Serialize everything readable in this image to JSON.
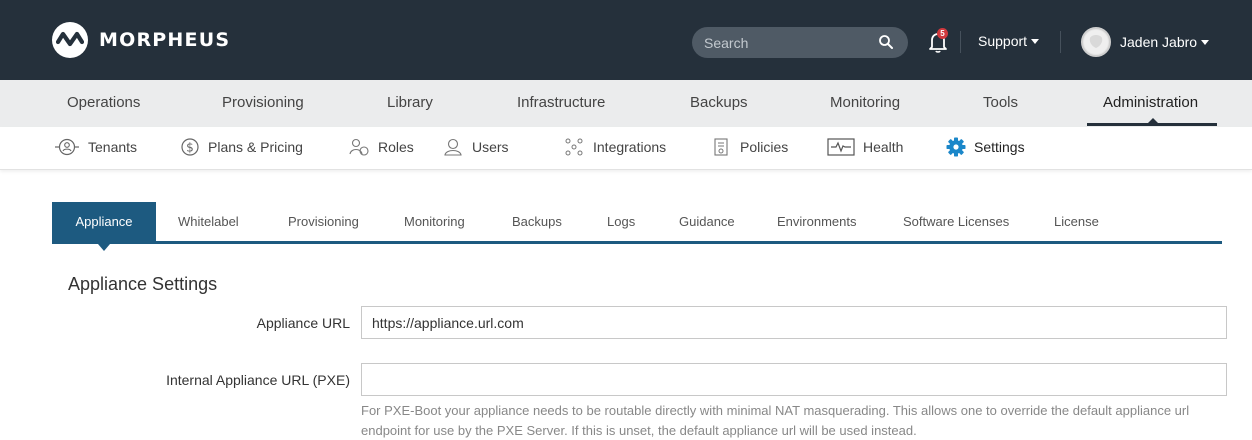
{
  "brand": {
    "name": "MORPHEUS"
  },
  "header": {
    "search_placeholder": "Search",
    "notifications_count": "5",
    "support_label": "Support",
    "user_name": "Jaden Jabro"
  },
  "main_nav": {
    "items": [
      "Operations",
      "Provisioning",
      "Library",
      "Infrastructure",
      "Backups",
      "Monitoring",
      "Tools",
      "Administration"
    ],
    "active": "Administration"
  },
  "sub_nav": {
    "items": [
      {
        "label": "Tenants",
        "icon": "tenants-icon"
      },
      {
        "label": "Plans & Pricing",
        "icon": "dollar-icon"
      },
      {
        "label": "Roles",
        "icon": "roles-icon"
      },
      {
        "label": "Users",
        "icon": "user-icon"
      },
      {
        "label": "Integrations",
        "icon": "integrations-icon"
      },
      {
        "label": "Policies",
        "icon": "policies-icon"
      },
      {
        "label": "Health",
        "icon": "health-icon"
      },
      {
        "label": "Settings",
        "icon": "gear-icon"
      }
    ],
    "active": "Settings"
  },
  "tabs": {
    "items": [
      "Appliance",
      "Whitelabel",
      "Provisioning",
      "Monitoring",
      "Backups",
      "Logs",
      "Guidance",
      "Environments",
      "Software Licenses",
      "License"
    ],
    "active": "Appliance"
  },
  "form": {
    "section_title": "Appliance Settings",
    "appliance_url_label": "Appliance URL",
    "appliance_url_value": "https://appliance.url.com",
    "internal_url_label": "Internal Appliance URL (PXE)",
    "internal_url_value": "",
    "internal_url_help": "For PXE-Boot your appliance needs to be routable directly with minimal NAT masquerading. This allows one to override the default appliance url endpoint for use by the PXE Server. If this is unset, the default appliance url will be used instead."
  },
  "colors": {
    "header_bg": "#25303b",
    "nav_bg": "#ebeced",
    "accent": "#1d5a80",
    "settings_icon": "#1b87c9",
    "badge": "#d0393e"
  }
}
